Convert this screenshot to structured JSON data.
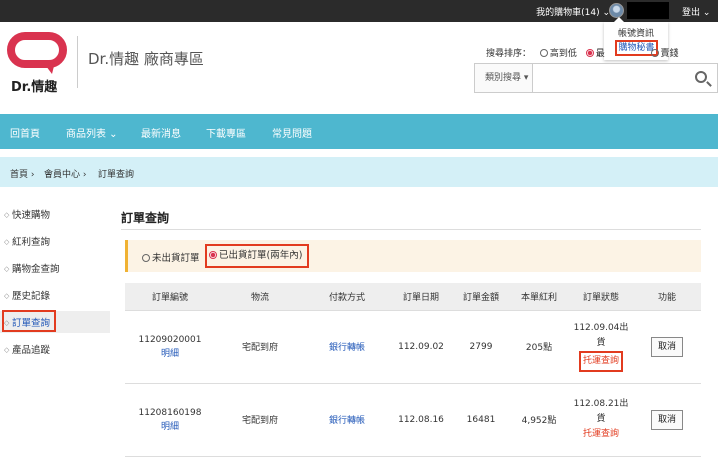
{
  "topbar": {
    "cart_label": "我的購物車(14) ⌄",
    "logout_label": "登出 ⌄"
  },
  "account_menu": {
    "items": [
      "帳號資訊",
      "購物秘書"
    ]
  },
  "header": {
    "logo_text": "Dr.情趣",
    "site_title": "Dr.情趣 廠商專區"
  },
  "sort": {
    "label": "搜尋排序：",
    "options": [
      "高到低",
      "最",
      "賣錢"
    ]
  },
  "search": {
    "category_label": "類別搜尋 ▾",
    "placeholder": ""
  },
  "nav": {
    "items": [
      "回首頁",
      "商品列表 ⌄",
      "最新消息",
      "下載專區",
      "常見問題"
    ]
  },
  "breadcrumb": {
    "items": [
      "首頁 ›",
      "會員中心 ›",
      "訂單查詢"
    ]
  },
  "sidebar": {
    "items": [
      "快速購物",
      "紅利查詢",
      "購物金查詢",
      "歷史記錄",
      "訂單查詢",
      "產品追蹤"
    ]
  },
  "main": {
    "title": "訂單查詢",
    "tabs": [
      "未出貨訂單",
      "已出貨訂單(兩年內)"
    ]
  },
  "table": {
    "headers": [
      "訂單編號",
      "物流",
      "付款方式",
      "訂單日期",
      "訂單金額",
      "本單紅利",
      "訂單狀態",
      "功能"
    ],
    "rows": [
      {
        "order_no": "11209020001",
        "detail": "明細",
        "shipping": "宅配到府",
        "payment": "銀行轉帳",
        "date": "112.09.02",
        "amount": "2799",
        "bonus": "205點",
        "status_line1": "112.09.04出",
        "status_line2": "貨",
        "tracking": "托運查詢",
        "action": "取消"
      },
      {
        "order_no": "11208160198",
        "detail": "明細",
        "shipping": "宅配到府",
        "payment": "銀行轉帳",
        "date": "112.08.16",
        "amount": "16481",
        "bonus": "4,952點",
        "status_line1": "112.08.21出",
        "status_line2": "貨",
        "tracking": "托運查詢",
        "action": "取消"
      }
    ]
  },
  "colors": {
    "nav_bg": "#4eb7cf",
    "breadcrumb_bg": "#d4f0f7",
    "brand": "#d9334f",
    "highlight_box": "#e23b1f",
    "link": "#2258b8"
  }
}
